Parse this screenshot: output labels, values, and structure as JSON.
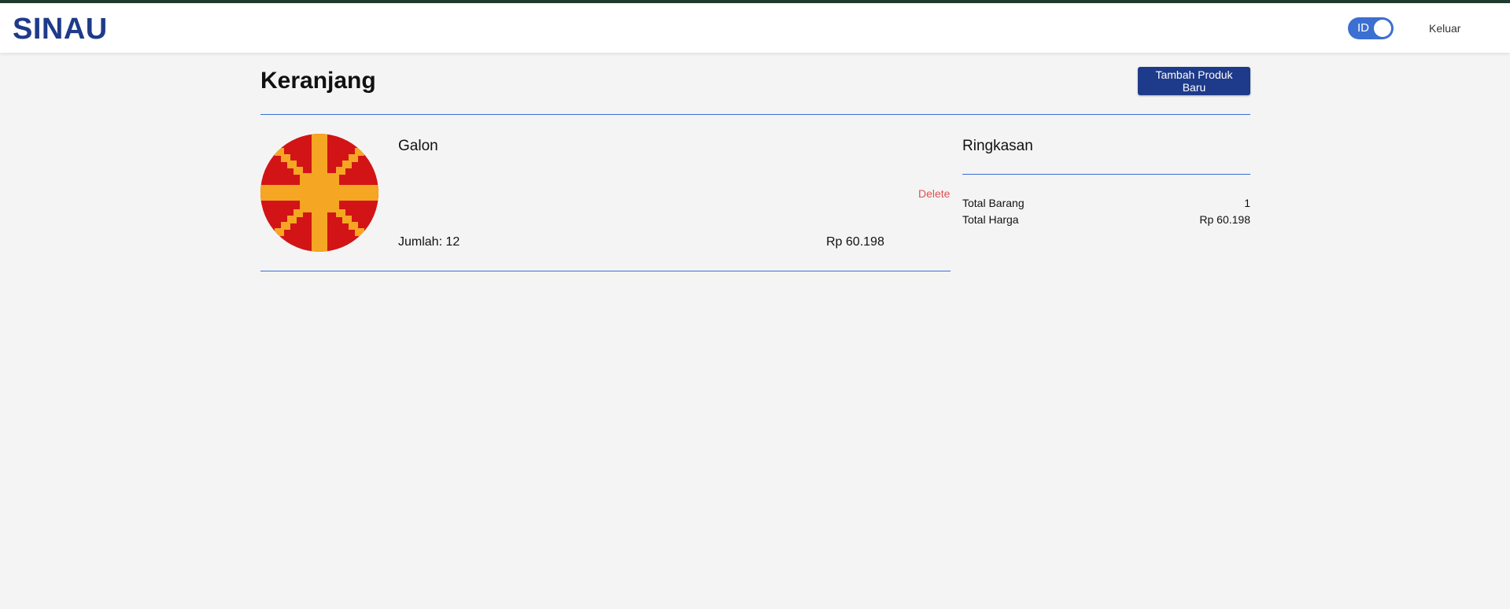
{
  "header": {
    "logo": "SINAU",
    "language_toggle": "ID",
    "logout_label": "Keluar"
  },
  "page": {
    "title": "Keranjang",
    "add_product_label": "Tambah Produk Baru"
  },
  "cart": {
    "items": [
      {
        "name": "Galon",
        "delete_label": "Delete",
        "quantity_text": "Jumlah: 12",
        "price": "Rp 60.198",
        "image_icon": "sunburst-pattern-image"
      }
    ]
  },
  "summary": {
    "title": "Ringkasan",
    "rows": [
      {
        "label": "Total Barang",
        "value": "1"
      },
      {
        "label": "Total Harga",
        "value": "Rp 60.198"
      }
    ]
  },
  "colors": {
    "brand": "#1e3a8a",
    "accent": "#3b6fd1",
    "danger": "#e05252",
    "image_red": "#d21416",
    "image_orange": "#f5a623"
  }
}
